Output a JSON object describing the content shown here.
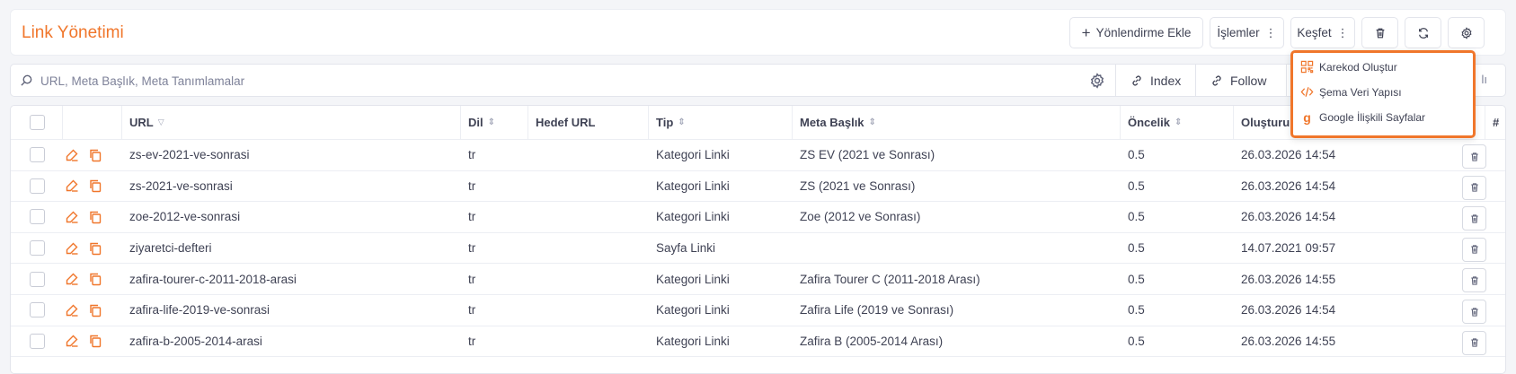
{
  "header": {
    "title": "Link Yönetimi",
    "add_redirect_label": "Yönlendirme Ekle",
    "operations_label": "İşlemler",
    "discover_label": "Keşfet"
  },
  "search": {
    "placeholder": "URL, Meta Başlık, Meta Tanımlamalar",
    "index_label": "Index",
    "follow_label": "Follow",
    "tail_text": "lı"
  },
  "dropdown": {
    "items": [
      {
        "label": "Karekod Oluştur",
        "icon": "qrcode-icon"
      },
      {
        "label": "Şema Veri Yapısı",
        "icon": "code-icon"
      },
      {
        "label": "Google İlişkili Sayfalar",
        "icon": "google-icon"
      }
    ]
  },
  "table": {
    "columns": [
      "URL",
      "Dil",
      "Hedef URL",
      "Tip",
      "Meta Başlık",
      "Öncelik",
      "Oluşturulm",
      "#"
    ],
    "rows": [
      {
        "url": "zs-ev-2021-ve-sonrasi",
        "lang": "tr",
        "target": "",
        "type": "Kategori Linki",
        "meta": "ZS EV (2021 ve Sonrası)",
        "priority": "0.5",
        "created": "26.03.2026 14:54"
      },
      {
        "url": "zs-2021-ve-sonrasi",
        "lang": "tr",
        "target": "",
        "type": "Kategori Linki",
        "meta": "ZS (2021 ve Sonrası)",
        "priority": "0.5",
        "created": "26.03.2026 14:54"
      },
      {
        "url": "zoe-2012-ve-sonrasi",
        "lang": "tr",
        "target": "",
        "type": "Kategori Linki",
        "meta": "Zoe (2012 ve Sonrası)",
        "priority": "0.5",
        "created": "26.03.2026 14:54"
      },
      {
        "url": "ziyaretci-defteri",
        "lang": "tr",
        "target": "",
        "type": "Sayfa Linki",
        "meta": "",
        "priority": "0.5",
        "created": "14.07.2021 09:57"
      },
      {
        "url": "zafira-tourer-c-2011-2018-arasi",
        "lang": "tr",
        "target": "",
        "type": "Kategori Linki",
        "meta": "Zafira Tourer C (2011-2018 Arası)",
        "priority": "0.5",
        "created": "26.03.2026 14:55"
      },
      {
        "url": "zafira-life-2019-ve-sonrasi",
        "lang": "tr",
        "target": "",
        "type": "Kategori Linki",
        "meta": "Zafira Life (2019 ve Sonrası)",
        "priority": "0.5",
        "created": "26.03.2026 14:54"
      },
      {
        "url": "zafira-b-2005-2014-arasi",
        "lang": "tr",
        "target": "",
        "type": "Kategori Linki",
        "meta": "Zafira B (2005-2014 Arası)",
        "priority": "0.5",
        "created": "26.03.2026 14:55"
      }
    ]
  },
  "colors": {
    "accent": "#f0762b",
    "text": "#3f4254",
    "muted": "#7e8299",
    "border": "#e3e5ec"
  }
}
